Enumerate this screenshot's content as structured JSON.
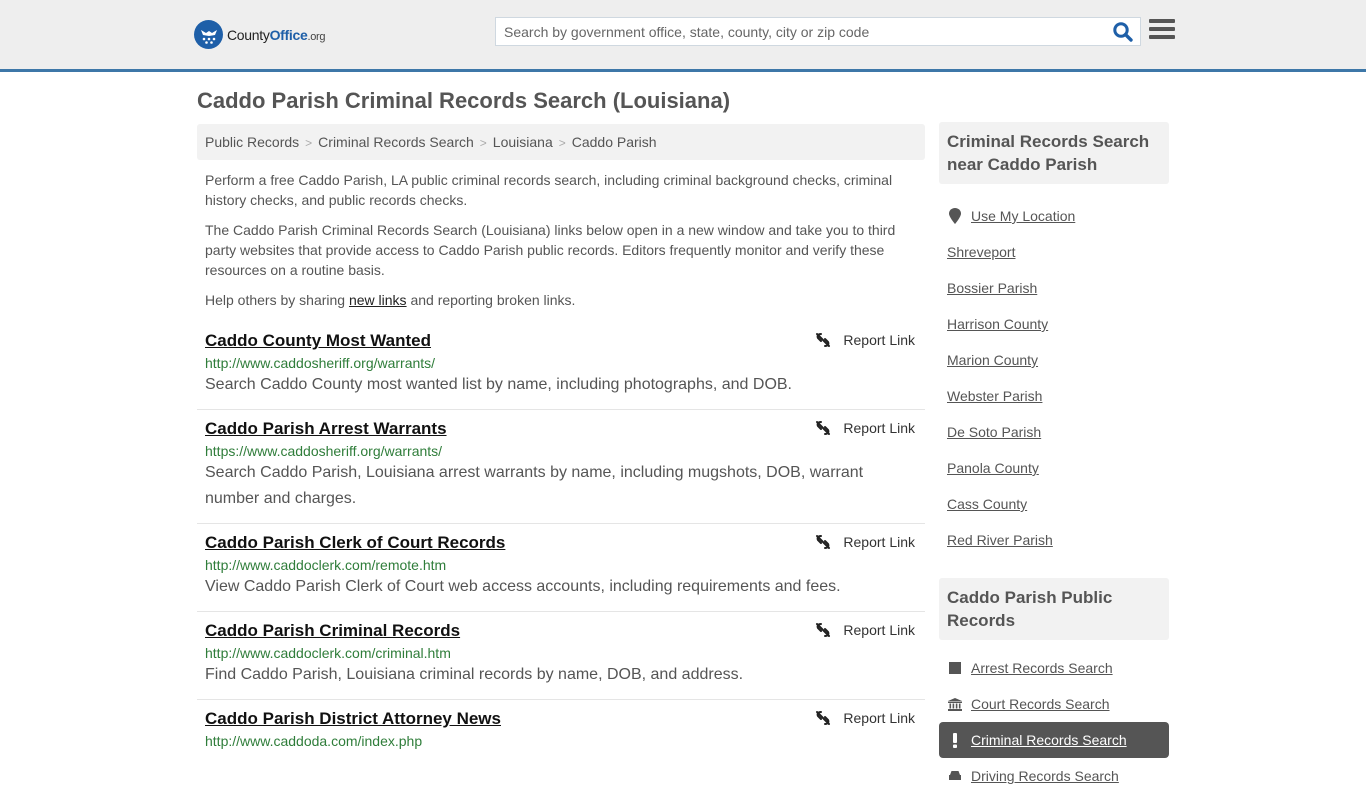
{
  "header": {
    "logo": {
      "brand_a": "County",
      "brand_b": "Office",
      "brand_c": ".org"
    },
    "search_placeholder": "Search by government office, state, county, city or zip code",
    "search_value": "",
    "search_icon": "search-icon",
    "menu_icon": "hamburger-menu-icon"
  },
  "page_title": "Caddo Parish Criminal Records Search (Louisiana)",
  "breadcrumb": [
    {
      "label": "Public Records"
    },
    {
      "label": "Criminal Records Search"
    },
    {
      "label": "Louisiana"
    },
    {
      "label": "Caddo Parish"
    }
  ],
  "breadcrumb_separator": ">",
  "intro": {
    "p1": "Perform a free Caddo Parish, LA public criminal records search, including criminal background checks, criminal history checks, and public records checks.",
    "p2": "The Caddo Parish Criminal Records Search (Louisiana) links below open in a new window and take you to third party websites that provide access to Caddo Parish public records. Editors frequently monitor and verify these resources on a routine basis.",
    "p3_before": "Help others by sharing ",
    "p3_link": "new links",
    "p3_after": " and reporting broken links."
  },
  "report_label": "Report Link",
  "results": [
    {
      "title": "Caddo County Most Wanted",
      "url": "http://www.caddosheriff.org/warrants/",
      "desc": "Search Caddo County most wanted list by name, including photographs, and DOB."
    },
    {
      "title": "Caddo Parish Arrest Warrants",
      "url": "https://www.caddosheriff.org/warrants/",
      "desc": "Search Caddo Parish, Louisiana arrest warrants by name, including mugshots, DOB, warrant number and charges."
    },
    {
      "title": "Caddo Parish Clerk of Court Records",
      "url": "http://www.caddoclerk.com/remote.htm",
      "desc": "View Caddo Parish Clerk of Court web access accounts, including requirements and fees."
    },
    {
      "title": "Caddo Parish Criminal Records",
      "url": "http://www.caddoclerk.com/criminal.htm",
      "desc": "Find Caddo Parish, Louisiana criminal records by name, DOB, and address."
    },
    {
      "title": "Caddo Parish District Attorney News",
      "url": "http://www.caddoda.com/index.php",
      "desc": ""
    }
  ],
  "sidebar": {
    "nearby_heading": "Criminal Records Search near Caddo Parish",
    "use_location": "Use My Location",
    "nearby": [
      "Shreveport",
      "Bossier Parish",
      "Harrison County",
      "Marion County",
      "Webster Parish",
      "De Soto Parish",
      "Panola County",
      "Cass County",
      "Red River Parish"
    ],
    "public_heading": "Caddo Parish Public Records",
    "public_records": [
      {
        "label": "Arrest Records Search",
        "icon": "square-icon",
        "active": false
      },
      {
        "label": "Court Records Search",
        "icon": "courthouse-icon",
        "active": false
      },
      {
        "label": "Criminal Records Search",
        "icon": "exclamation-icon",
        "active": true
      },
      {
        "label": "Driving Records Search",
        "icon": "car-icon",
        "active": false
      }
    ]
  },
  "colors": {
    "accent": "#3d77a8",
    "brand": "#1e5fa8",
    "url_green": "#2f7d3a",
    "active_bg": "#555555"
  }
}
